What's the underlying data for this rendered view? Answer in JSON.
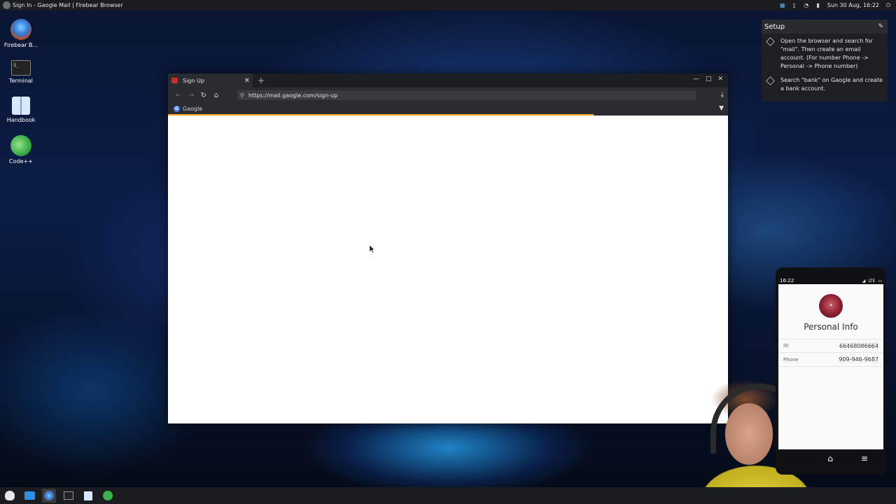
{
  "topbar": {
    "title": "Sign In - Gaogle Mail | Firebear Browser",
    "datetime": "Sun 30 Aug, 16:22",
    "icons": [
      "network-icon",
      "phone-icon",
      "wifi-icon",
      "battery-icon",
      "power-icon"
    ]
  },
  "desktop": {
    "icons": [
      {
        "label": "Firebear B...",
        "icon": "firebear-browser-icon"
      },
      {
        "label": "Terminal",
        "icon": "terminal-icon"
      },
      {
        "label": "Handbook",
        "icon": "handbook-icon"
      },
      {
        "label": "Code++",
        "icon": "code-plus-plus-icon"
      }
    ]
  },
  "browser": {
    "tab_title": "Sign Up",
    "url": "https://mail.gaogle.com/sign-up",
    "bookmark": "Gaogle",
    "load_progress_percent": 76
  },
  "setup": {
    "title": "Setup",
    "tasks": [
      "Open the browser and search for \"mail\". Then create an email account. (For number Phone -> Personal -> Phone number)",
      "Search \"bank\" on Gaogle and create a bank account."
    ]
  },
  "phone": {
    "time": "16:22",
    "network": "LTE",
    "title": "Personal Info",
    "fields": [
      {
        "key": "ID",
        "value": "66468086664"
      },
      {
        "key": "Phone",
        "value": "909-946-9687"
      }
    ]
  },
  "taskbar": {
    "apps": [
      "bear-menu-icon",
      "files-icon",
      "firebear-browser-icon",
      "terminal-icon",
      "handbook-icon",
      "code-plus-plus-icon"
    ]
  },
  "colors": {
    "progress": "#f3a61d",
    "chrome_dark": "#2b2c30",
    "tab_favicon": "#d02a2a"
  }
}
